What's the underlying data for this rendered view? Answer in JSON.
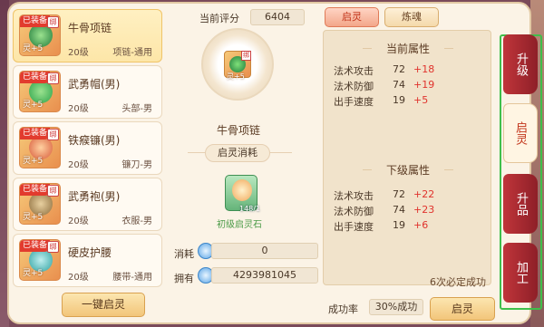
{
  "score_label": "当前评分",
  "score_value": "6404",
  "equipment_list": [
    {
      "equipped": true,
      "name": "牛骨项链",
      "level": "20级",
      "slot": "项链-通用",
      "lock": "绑",
      "plus": "灵+5",
      "gem_color": "#1f7a3a",
      "selected": true
    },
    {
      "equipped": true,
      "name": "武勇帽(男)",
      "level": "20级",
      "slot": "头部-男",
      "lock": "绑",
      "plus": "灵+5",
      "gem_color": "#2aa24a",
      "selected": false
    },
    {
      "equipped": true,
      "name": "铁瘊镰(男)",
      "level": "20级",
      "slot": "镰刀-男",
      "lock": "绑",
      "plus": "灵+5",
      "gem_color": "#d85a3a",
      "selected": false
    },
    {
      "equipped": true,
      "name": "武勇袍(男)",
      "level": "20级",
      "slot": "衣服-男",
      "lock": "绑",
      "plus": "灵+5",
      "gem_color": "#8a6a3a",
      "selected": false
    },
    {
      "equipped": true,
      "name": "硬皮护腰",
      "level": "20级",
      "slot": "腰带-通用",
      "lock": "绑",
      "plus": "灵+5",
      "gem_color": "#2aa0a0",
      "selected": false
    }
  ],
  "equipped_tag": "已装备",
  "center": {
    "item_name": "牛骨项链",
    "lock": "绑",
    "plus": "灵+5",
    "consume_title": "启灵消耗",
    "stone_name": "初级启灵石",
    "stone_count": "148/1",
    "consume_label": "消耗",
    "consume_value": "0",
    "own_label": "拥有",
    "own_value": "4293981045"
  },
  "tabs": [
    "启灵",
    "炼魂"
  ],
  "current_attr": {
    "title": "当前属性",
    "rows": [
      {
        "name": "法术攻击",
        "value": "72",
        "plus": "+18"
      },
      {
        "name": "法术防御",
        "value": "74",
        "plus": "+19"
      },
      {
        "name": "出手速度",
        "value": "19",
        "plus": "+5"
      }
    ]
  },
  "next_attr": {
    "title": "下级属性",
    "rows": [
      {
        "name": "法术攻击",
        "value": "72",
        "plus": "+22"
      },
      {
        "name": "法术防御",
        "value": "74",
        "plus": "+23"
      },
      {
        "name": "出手速度",
        "value": "19",
        "plus": "+6"
      }
    ]
  },
  "note": "6次必定成功",
  "success_label": "成功率",
  "success_value": "30%成功",
  "buttons": {
    "one_key": "一键启灵",
    "awaken": "启灵"
  },
  "side_tabs": [
    "升级",
    "启灵",
    "升品",
    "加工"
  ]
}
